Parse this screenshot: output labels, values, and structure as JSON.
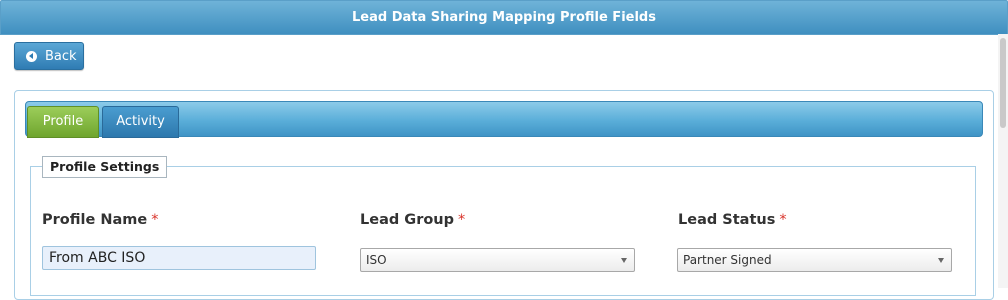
{
  "header": {
    "title": "Lead Data Sharing Mapping Profile Fields"
  },
  "toolbar": {
    "back_label": "Back"
  },
  "tabs": [
    {
      "label": "Profile",
      "active": true
    },
    {
      "label": "Activity",
      "active": false
    }
  ],
  "section": {
    "legend": "Profile Settings"
  },
  "fields": {
    "profile_name": {
      "label": "Profile Name",
      "required": "*",
      "value": "From ABC ISO"
    },
    "lead_group": {
      "label": "Lead Group",
      "required": "*",
      "selected": "ISO"
    },
    "lead_status": {
      "label": "Lead Status",
      "required": "*",
      "selected": "Partner Signed"
    }
  },
  "colors": {
    "header_blue": "#4f9ccb",
    "active_tab_green": "#7fb43f",
    "required_red": "#d9342b"
  }
}
